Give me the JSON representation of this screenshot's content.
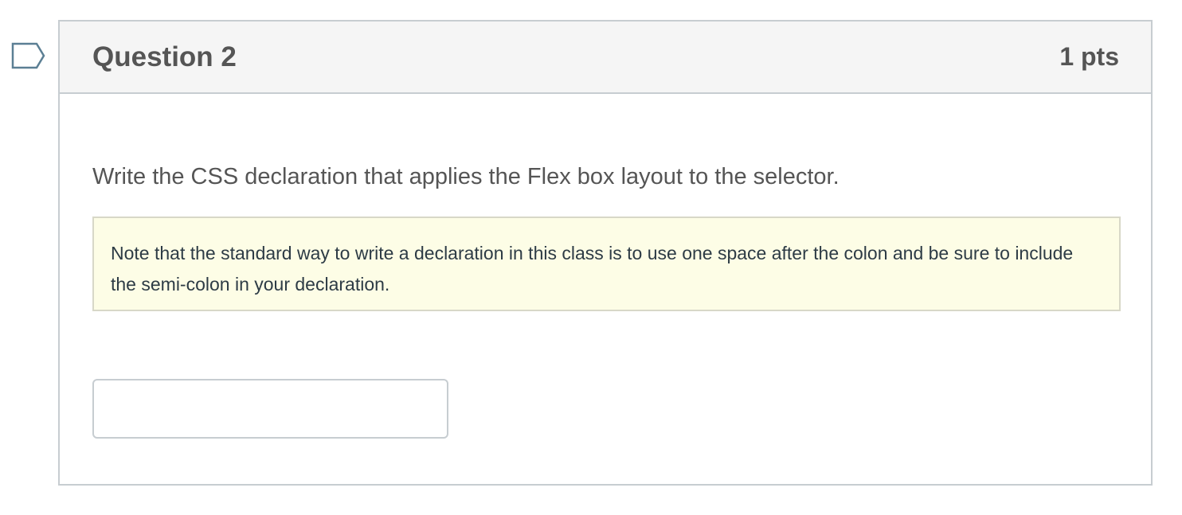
{
  "question": {
    "title": "Question 2",
    "points": "1 pts",
    "prompt": "Write the CSS declaration that applies the Flex box layout to the selector.",
    "note": "Note that the standard way to write a declaration in this class is to use one space after the colon and be sure to include the semi-colon in your declaration.",
    "answer": {
      "value": "",
      "placeholder": ""
    }
  },
  "icons": {
    "flag": "bookmark-flag-icon"
  },
  "colors": {
    "header_bg": "#f5f5f5",
    "border": "#c7cdd1",
    "note_bg": "#fdfde6",
    "text": "#555555",
    "flag_stroke": "#5b7f94"
  }
}
